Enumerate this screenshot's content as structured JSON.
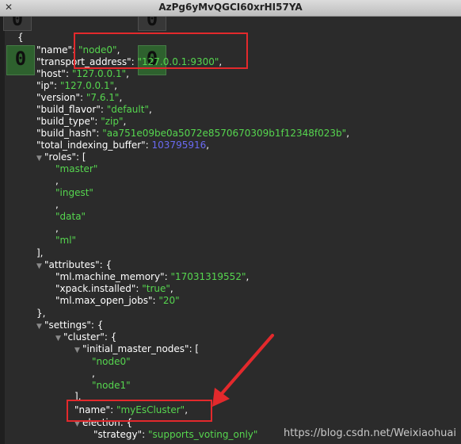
{
  "window": {
    "title": "AzPg6yMvQGCI60xrHI57YA",
    "close_icon": "close-icon"
  },
  "ghost_digit": "0",
  "json": {
    "open_brace": "{",
    "name_key": "\"name\"",
    "name_value": "\"node0\"",
    "transport_key": "\"transport_address\"",
    "transport_value": "\"127.0.0.1:9300\"",
    "host_key": "\"host\"",
    "host_value": "\"127.0.0.1\"",
    "ip_key": "\"ip\"",
    "ip_value": "\"127.0.0.1\"",
    "version_key": "\"version\"",
    "version_value": "\"7.6.1\"",
    "build_flavor_key": "\"build_flavor\"",
    "build_flavor_value": "\"default\"",
    "build_type_key": "\"build_type\"",
    "build_type_value": "\"zip\"",
    "build_hash_key": "\"build_hash\"",
    "build_hash_value": "\"aa751e09be0a5072e8570670309b1f12348f023b\"",
    "total_indexing_buffer_key": "\"total_indexing_buffer\"",
    "total_indexing_buffer_value": "103795916",
    "roles_key": "\"roles\"",
    "roles": [
      "\"master\"",
      "\"ingest\"",
      "\"data\"",
      "\"ml\""
    ],
    "attributes_key": "\"attributes\"",
    "ml_machine_memory_key": "\"ml.machine_memory\"",
    "ml_machine_memory_value": "\"17031319552\"",
    "xpack_installed_key": "\"xpack.installed\"",
    "xpack_installed_value": "\"true\"",
    "ml_max_open_jobs_key": "\"ml.max_open_jobs\"",
    "ml_max_open_jobs_value": "\"20\"",
    "settings_key": "\"settings\"",
    "cluster_key": "\"cluster\"",
    "initial_master_nodes_key": "\"initial_master_nodes\"",
    "initial_master_nodes": [
      "\"node0\"",
      "\"node1\""
    ],
    "cluster_name_key": "\"name\"",
    "cluster_name_value": "\"myEsCluster\"",
    "election_key": "election",
    "strategy_key": "\"strategy\"",
    "strategy_value": "\"supports_voting_only\""
  },
  "watermark": "https://blog.csdn.net/Weixiaohuai",
  "colors": {
    "key": "#ffffff",
    "string": "#56d64f",
    "number": "#6a6af2",
    "highlight": "#e3292c",
    "background": "#2b2b2b"
  }
}
